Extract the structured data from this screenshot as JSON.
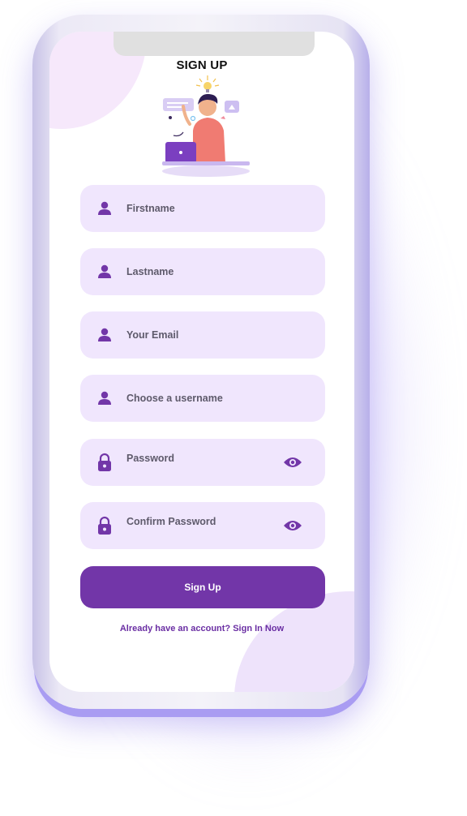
{
  "header": {
    "title": "SIGN UP"
  },
  "form": {
    "firstname_placeholder": "Firstname",
    "lastname_placeholder": "Lastname",
    "email_placeholder": "Your Email",
    "username_placeholder": "Choose a username",
    "password_placeholder": "Password",
    "confirm_password_placeholder": "Confirm Password"
  },
  "actions": {
    "signup_label": "Sign Up",
    "signin_text": "Already have an account? Sign In Now"
  },
  "icons": {
    "field_person": "person-icon",
    "field_lock": "lock-icon",
    "toggle_visibility": "eye-icon"
  },
  "colors": {
    "accent": "#7236a8",
    "field_background": "#f0e6fd",
    "link": "#6a2ea3"
  }
}
